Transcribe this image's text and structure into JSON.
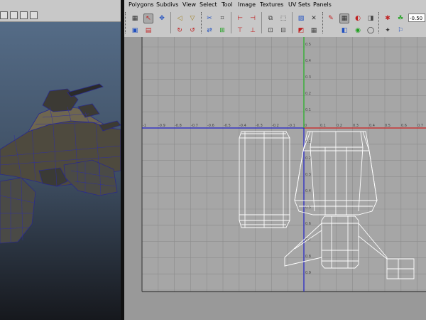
{
  "menu": [
    "Polygons",
    "Subdivs",
    "View",
    "Select",
    "Tool",
    "Image",
    "Textures",
    "UV Sets",
    "Panels"
  ],
  "toolbar": {
    "field_value": "-0.50"
  },
  "axis_labels": {
    "x_neg": [
      "-1",
      "-0.9",
      "-0.8",
      "-0.7",
      "-0.6",
      "-0.5",
      "-0.4",
      "-0.3",
      "-0.2",
      "-0.1"
    ],
    "x_pos": [
      "0",
      "0.1",
      "0.2",
      "0.3",
      "0.4",
      "0.5",
      "0.6",
      "0.7"
    ],
    "y_pos": [
      "0.5",
      "0.4",
      "0.3",
      "0.2",
      "0.1"
    ],
    "y_neg": [
      "0.1",
      "0.2",
      "0.3",
      "0.4",
      "0.5",
      "0.6",
      "0.7",
      "0.8",
      "0.9"
    ]
  },
  "colors": {
    "x_axis_negative": "#2020c8",
    "x_axis_positive": "#cc2020",
    "y_axis_positive": "#20b020",
    "uv_wire": "#ffffff",
    "grid": "#888888"
  },
  "icons": [
    "grid-icon",
    "uv-select-icon",
    "uv-move-icon",
    "rotate-uv-icon",
    "flip-uv-icon",
    "cut-uv-icon",
    "sew-uv-icon",
    "snapshot-icon",
    "display-image-icon",
    "checker-icon",
    "shaded-icon",
    "magnet-icon"
  ]
}
